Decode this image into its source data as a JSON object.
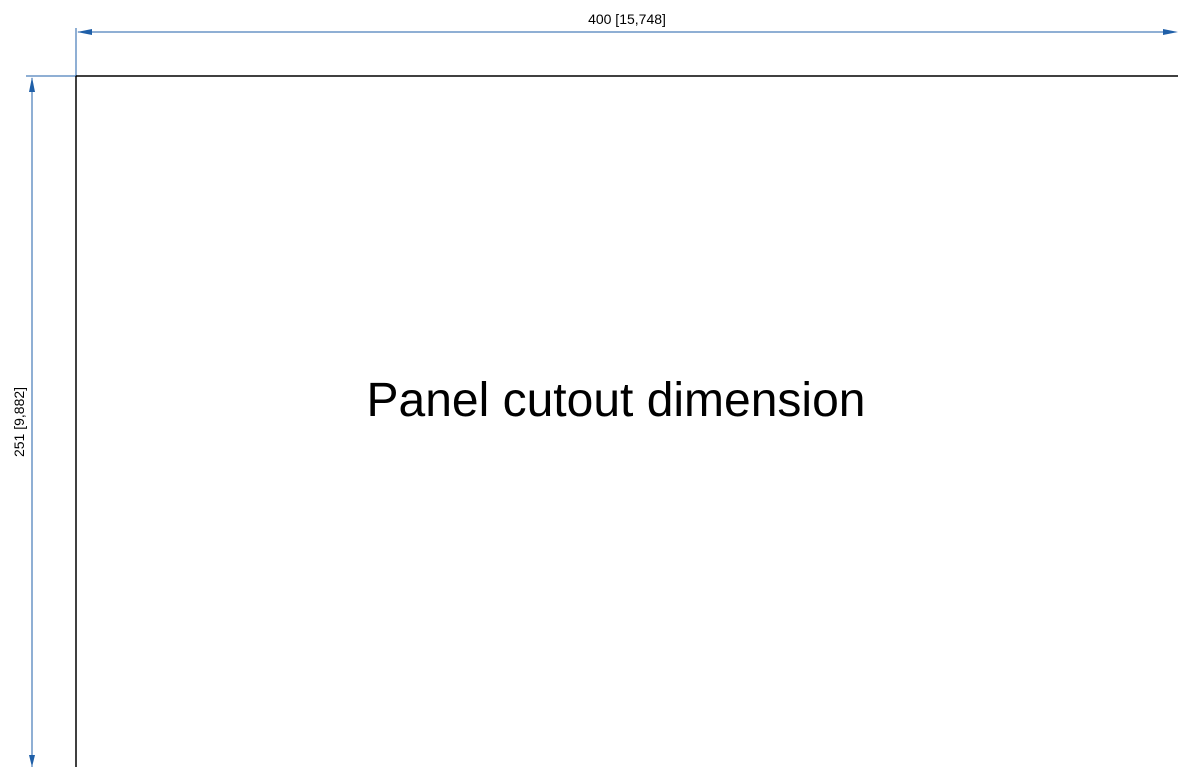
{
  "drawing": {
    "title": "Panel cutout dimension",
    "width_dimension": {
      "label": "400 [15,748]",
      "value_mm": 400,
      "value_in": "15,748"
    },
    "height_dimension": {
      "label": "251 [9,882]",
      "value_mm": 251,
      "value_in": "9,882"
    }
  },
  "colors": {
    "dimension_line": "#1f5fa8",
    "outline": "#000000",
    "text": "#000000",
    "background": "#ffffff"
  }
}
